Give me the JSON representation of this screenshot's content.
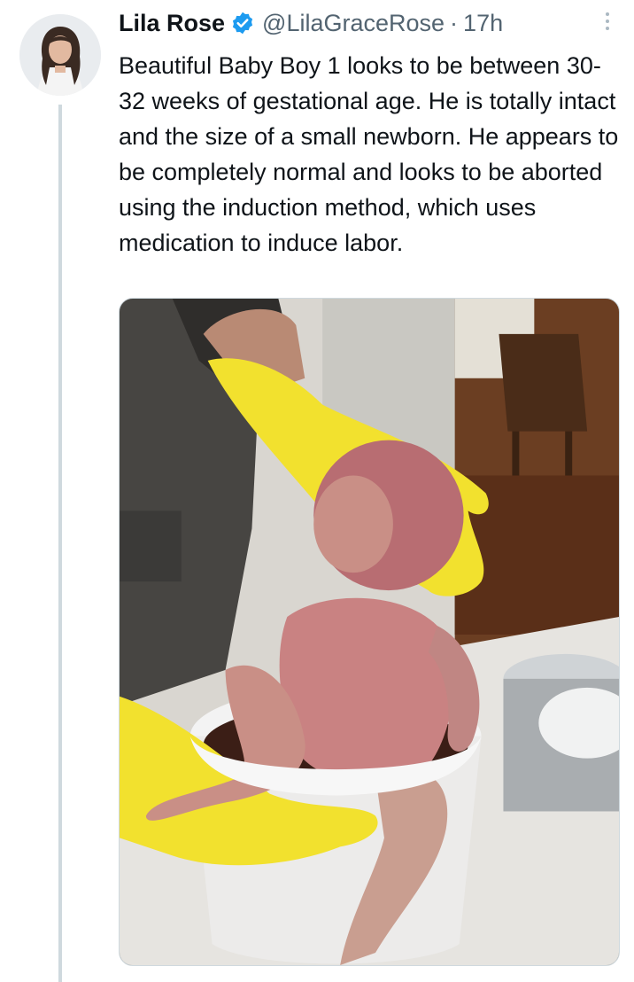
{
  "author": {
    "display_name": "Lila Rose",
    "handle": "@LilaGraceRose",
    "separator": "·",
    "timestamp": "17h",
    "verified": true,
    "avatar_icon": "profile-photo"
  },
  "tweet": {
    "text": "Beautiful Baby Boy 1 looks to be between 30-32 weeks of gestational age. He is totally intact and the size of a small newborn. He appears to be completely normal and looks to be aborted using the induction method, which uses medication to induce labor."
  },
  "icons": {
    "verified": "verified-badge-icon",
    "more": "more-options-icon"
  },
  "colors": {
    "verified_blue": "#1d9bf0",
    "secondary_text": "#536471",
    "thread_line": "#cfd9de",
    "glove_yellow": "#f2e12e"
  }
}
